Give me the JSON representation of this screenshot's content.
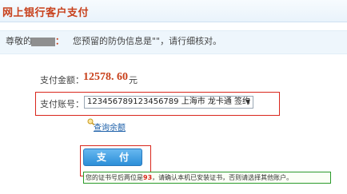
{
  "header": {
    "title": "网上银行客户支付"
  },
  "notice": {
    "greeting": "尊敬的",
    "colon": "：",
    "message": "您预留的防伪信息是\"\"，请行细核对。"
  },
  "payment": {
    "amount_label": "支付金额：",
    "amount_value": "12578. 60",
    "amount_unit": "元",
    "account_label": "支付账号：",
    "account_selected": "123456789123456789 上海市 龙卡通 签约",
    "query_link": "查询余额",
    "pay_button": "支 付"
  },
  "cert_note": {
    "prefix": "您的证书号后两位是",
    "digits": "93",
    "suffix": "，请确认本机已安装证书，否则请选择其他账户。"
  },
  "colors": {
    "accent_red": "#c8401b",
    "button_blue": "#2c8fd8",
    "link_blue": "#1a5ea8",
    "note_border_green": "#2b9a2b"
  },
  "icons": {
    "query": "magnifier-icon",
    "dropdown": "chevron-down-icon"
  }
}
